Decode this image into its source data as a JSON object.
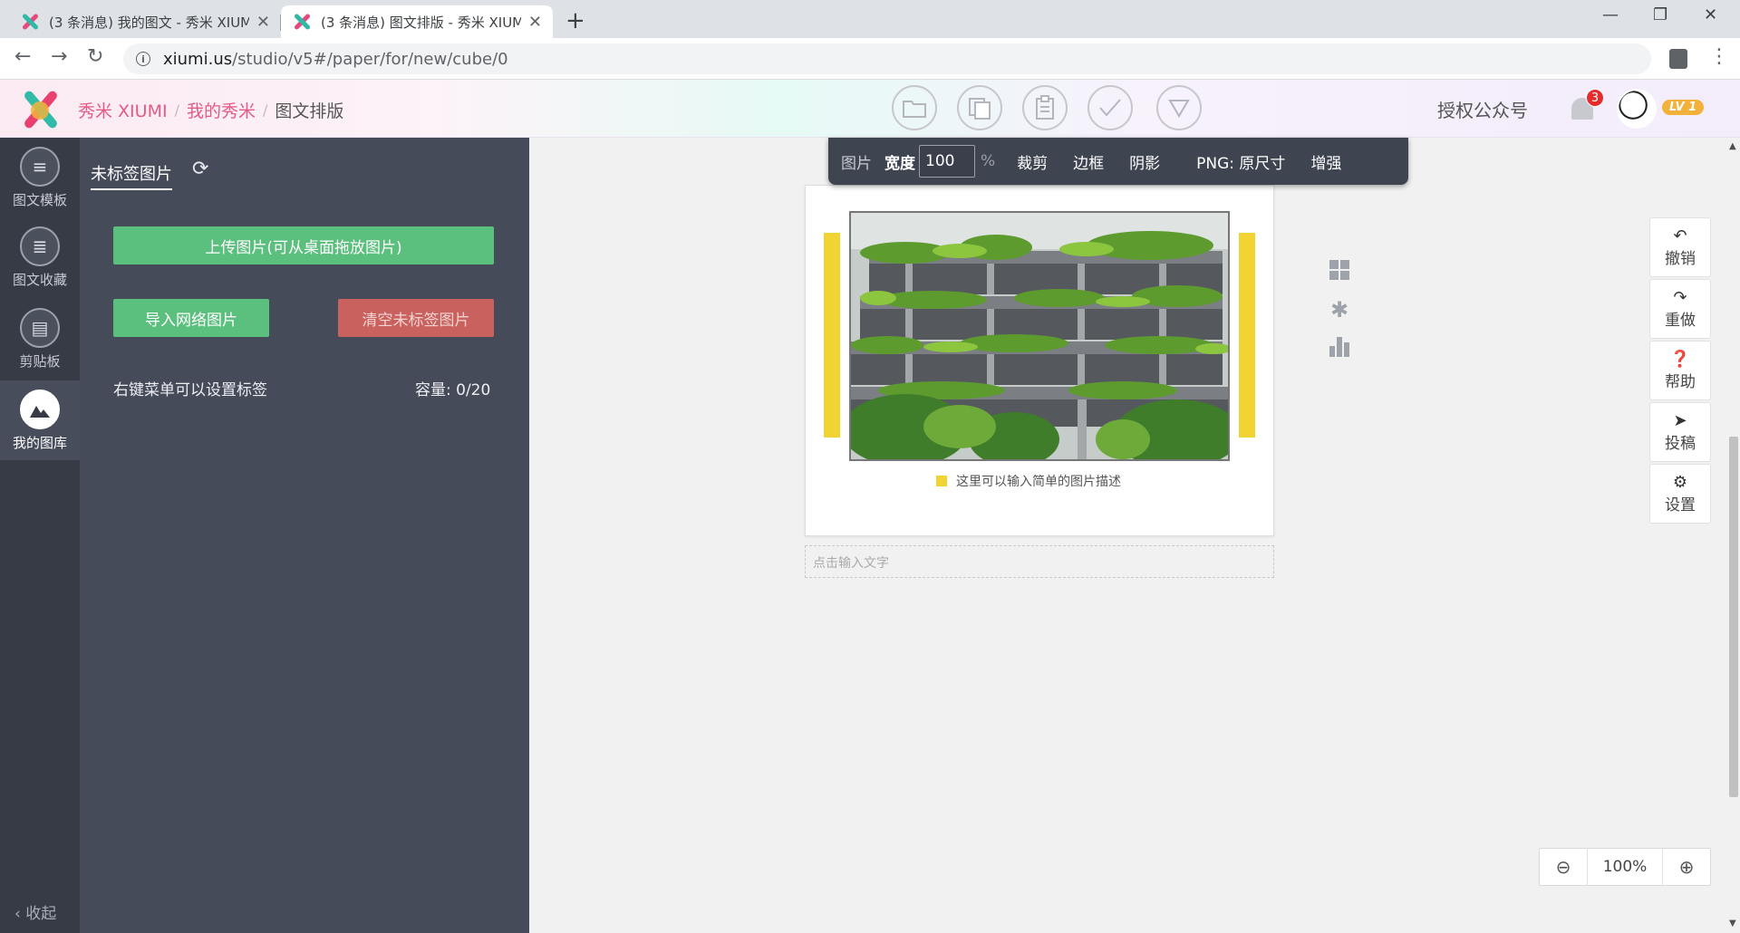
{
  "browser": {
    "tabs": [
      {
        "title": "(3 条消息) 我的图文 - 秀米 XIUMI",
        "active": false
      },
      {
        "title": "(3 条消息) 图文排版 - 秀米 XIUMI",
        "active": true
      }
    ],
    "new_tab": "+",
    "url_host": "xiumi.us",
    "url_path": "/studio/v5#/paper/for/new/cube/0"
  },
  "header": {
    "breadcrumbs": [
      "秀米 XIUMI",
      "我的秀米",
      "图文排版"
    ],
    "auth_label": "授权公众号",
    "notification_count": "3",
    "level": "LV 1",
    "tool_icons": [
      "folder-icon",
      "copy-icon",
      "paste-icon",
      "check-icon",
      "triangle-down-icon"
    ]
  },
  "rail": {
    "items": [
      {
        "label": "图文模板",
        "icon": "template-icon"
      },
      {
        "label": "图文收藏",
        "icon": "favorite-icon"
      },
      {
        "label": "剪贴板",
        "icon": "clipboard-icon"
      },
      {
        "label": "我的图库",
        "icon": "gallery-icon",
        "active": true
      }
    ],
    "collapse": "收起"
  },
  "library": {
    "tab_label": "未标签图片",
    "upload_button": "上传图片(可从桌面拖放图片)",
    "import_button": "导入网络图片",
    "clear_button": "清空未标签图片",
    "hint": "右键菜单可以设置标签",
    "capacity": "容量: 0/20"
  },
  "image_toolbar": {
    "type_label": "图片",
    "width_label": "宽度",
    "width_value": "100",
    "unit": "%",
    "crop": "裁剪",
    "border": "边框",
    "shadow": "阴影",
    "format": "PNG: 原尺寸",
    "enhance": "增强"
  },
  "canvas": {
    "caption": "这里可以输入简单的图片描述",
    "text_placeholder": "点击输入文字",
    "accent_color": "#f1d433"
  },
  "right_tools": [
    {
      "label": "撤销",
      "icon": "undo-icon"
    },
    {
      "label": "重做",
      "icon": "redo-icon"
    },
    {
      "label": "帮助",
      "icon": "help-icon"
    },
    {
      "label": "投稿",
      "icon": "send-icon"
    },
    {
      "label": "设置",
      "icon": "gear-icon"
    }
  ],
  "zoom": {
    "value": "100%"
  }
}
